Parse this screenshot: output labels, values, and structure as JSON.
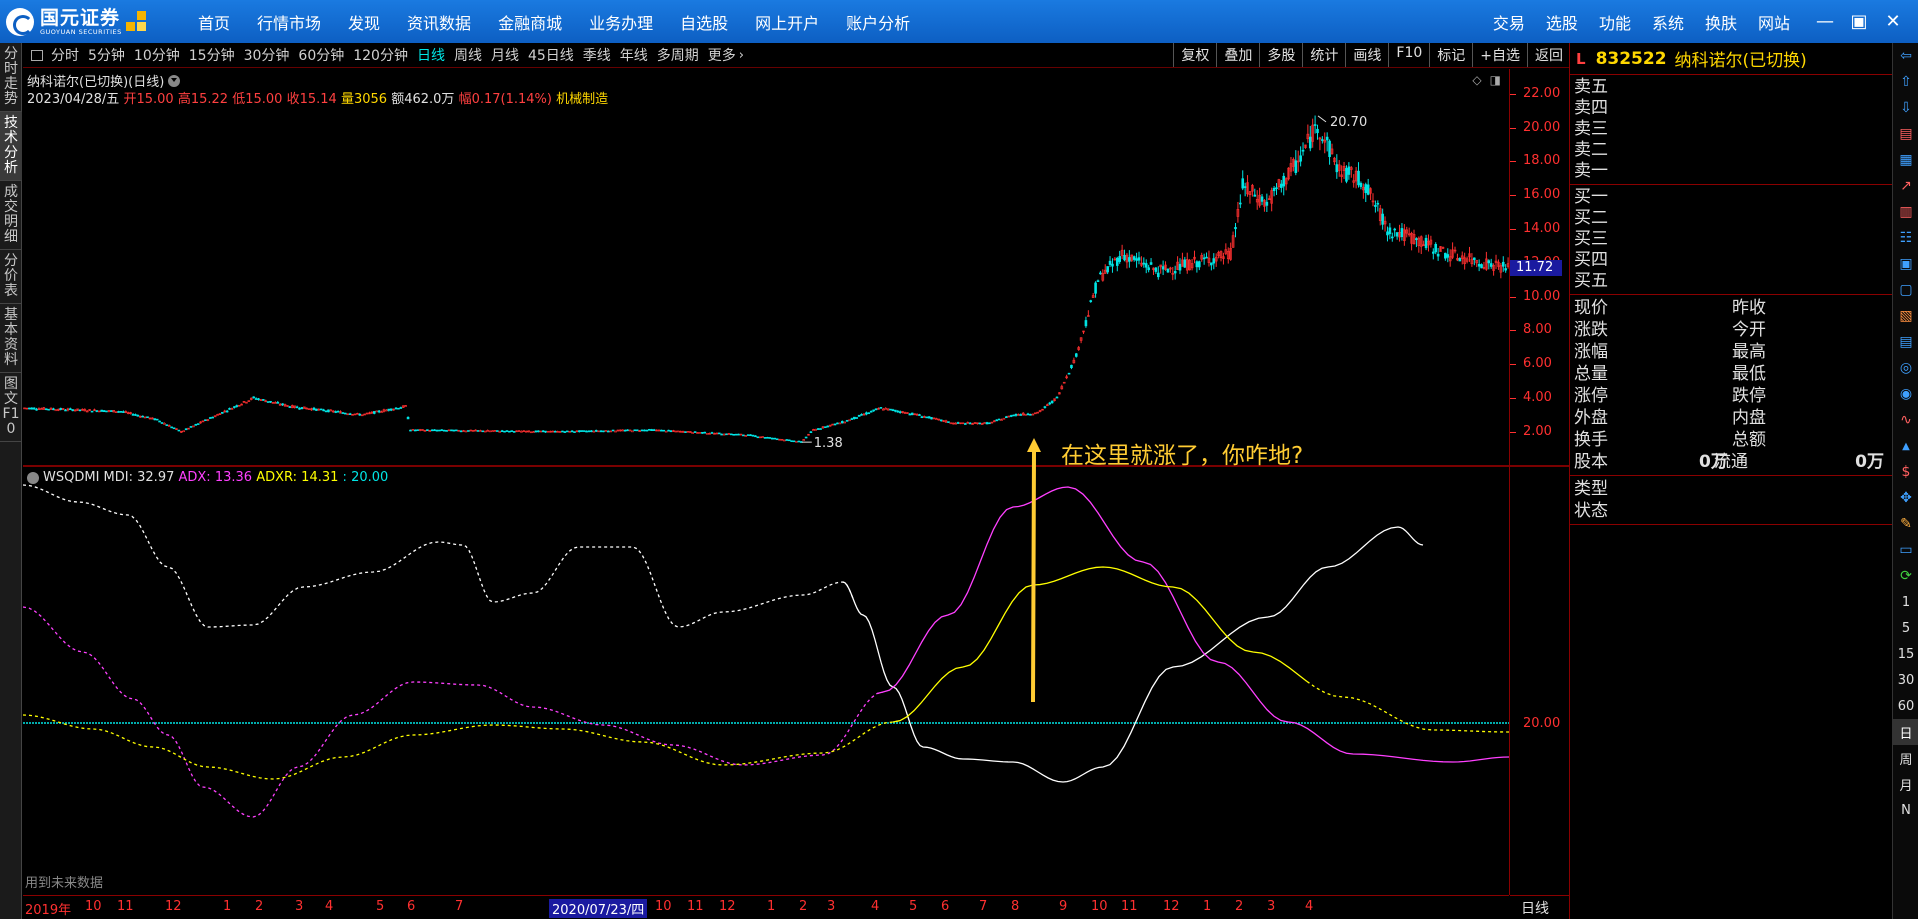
{
  "brand": {
    "name_cn": "国元证券",
    "name_en": "GUOYUAN SECURITIES"
  },
  "topnav": [
    "首页",
    "行情市场",
    "发现",
    "资讯数据",
    "金融商城",
    "业务办理",
    "自选股",
    "网上开户",
    "账户分析"
  ],
  "rightnav": [
    "交易",
    "选股",
    "功能",
    "系统",
    "换肤",
    "网站"
  ],
  "window_controls": [
    "—",
    "▣",
    "✕"
  ],
  "lefttabs": [
    "分时走势",
    "技术分析",
    "成交明细",
    "分价表",
    "基本资料",
    "图文F10"
  ],
  "periods": [
    "分时",
    "5分钟",
    "10分钟",
    "15分钟",
    "30分钟",
    "60分钟",
    "120分钟",
    "日线",
    "周线",
    "月线",
    "45日线",
    "季线",
    "年线",
    "多周期",
    "更多"
  ],
  "active_period": "日线",
  "right_tools": [
    "复权",
    "叠加",
    "多股",
    "统计",
    "画线",
    "F10",
    "标记",
    "+自选",
    "返回"
  ],
  "chart": {
    "stock_title": "纳科诺尔(已切换)(日线)",
    "date": "2023/04/28/五",
    "open_label": "开",
    "open": "15.00",
    "high_label": "高",
    "high": "15.22",
    "low_label": "低",
    "low": "15.00",
    "close_label": "收",
    "close": "15.14",
    "vol_label": "量",
    "vol": "3056",
    "amt_label": "额",
    "amt": "462.0万",
    "chg_label": "幅",
    "chg": "0.17(1.14%)",
    "industry": "机械制造",
    "max_label": "20.70",
    "min_label": "1.38",
    "current_price": "11.72",
    "price_ticks": [
      "22.00",
      "20.00",
      "18.00",
      "16.00",
      "14.00",
      "12.00",
      "10.00",
      "8.00",
      "6.00",
      "4.00",
      "2.00"
    ]
  },
  "indicator": {
    "name": "WSQDMI",
    "mdi_label": "MDI:",
    "mdi": "32.97",
    "adx_label": "ADX:",
    "adx": "13.36",
    "adxr_label": "ADXR:",
    "adxr": "14.31",
    "ref_label": ":",
    "ref": "20.00",
    "ref_tick": "20.00",
    "future_note": "用到未来数据"
  },
  "annotation": "在这里就涨了，你咋地?",
  "xaxis": {
    "labels": [
      "2019年",
      "10",
      "11",
      "12",
      "1",
      "2",
      "3",
      "4",
      "5",
      "6",
      "7",
      "2020/07/23/四",
      "10",
      "11",
      "12",
      "1",
      "2",
      "3",
      "4",
      "5",
      "6",
      "7",
      "8",
      "9",
      "10",
      "11",
      "12",
      "1",
      "2",
      "3",
      "4"
    ],
    "period": "日线"
  },
  "quote": {
    "l_mark": "L",
    "code": "832522",
    "name": "纳科诺尔(已切换)",
    "sell": [
      "卖五",
      "卖四",
      "卖三",
      "卖二",
      "卖一"
    ],
    "buy": [
      "买一",
      "买二",
      "买三",
      "买四",
      "买五"
    ],
    "stats_left": [
      "现价",
      "涨跌",
      "涨幅",
      "总量",
      "涨停",
      "外盘",
      "换手"
    ],
    "stats_right": [
      "昨收",
      "今开",
      "最高",
      "最低",
      "跌停",
      "内盘",
      "总额"
    ],
    "share_label": "股本",
    "share_value": "0万",
    "float_label": "流通",
    "float_value": "0万",
    "type_label": "类型",
    "status_label": "状态"
  },
  "side_tools_text": [
    "1",
    "5",
    "15",
    "30",
    "60",
    "日",
    "周",
    "月",
    "N"
  ],
  "side_tools_selected": "日",
  "colors": {
    "up": "#ff3030",
    "down": "#00e5e5",
    "mdi": "#ffffff",
    "adx": "#ff40ff",
    "adxr": "#ffff00",
    "ref": "#00e5e5",
    "accent": "#0d5fc3"
  }
}
